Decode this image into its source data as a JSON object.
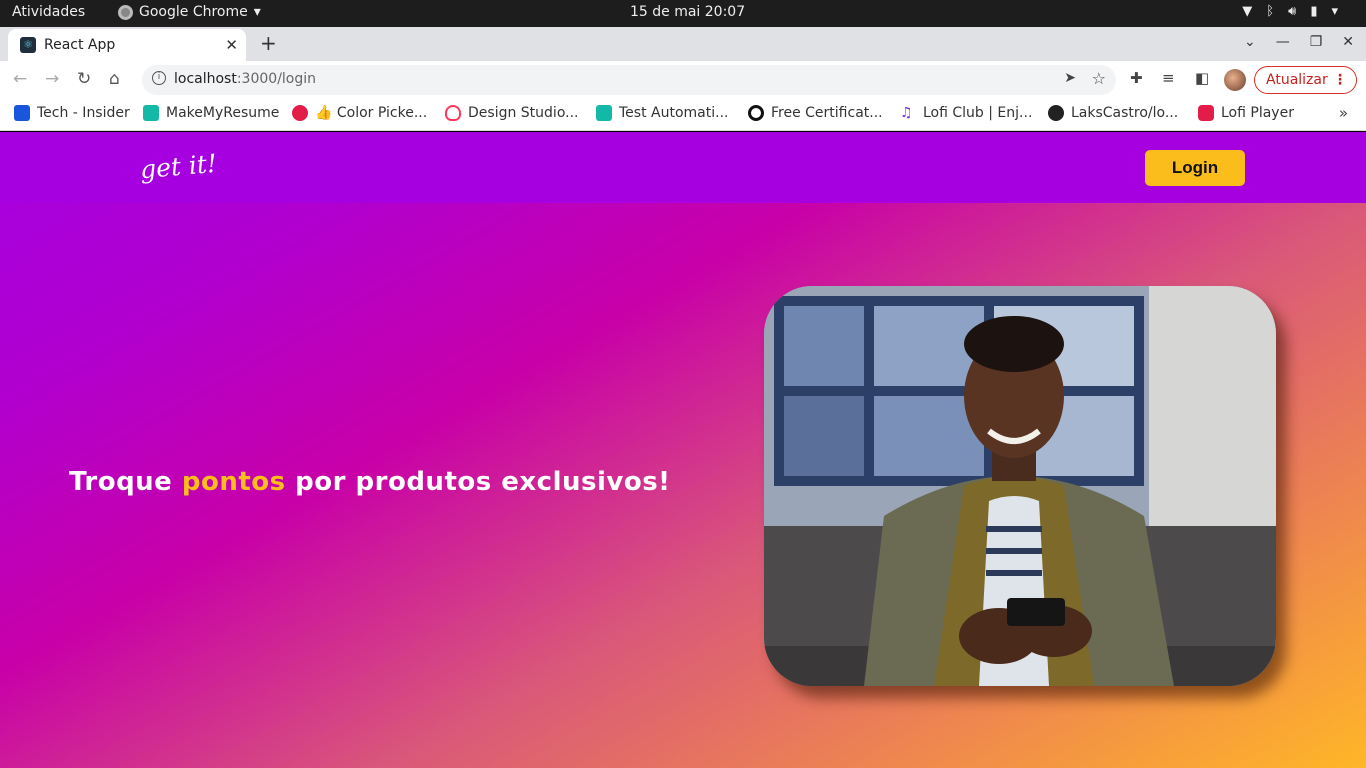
{
  "system": {
    "activities": "Atividades",
    "app_name": "Google Chrome",
    "clock": "15 de mai  20:07"
  },
  "browser": {
    "tab_title": "React App",
    "url_host": "localhost",
    "url_path": ":3000/login",
    "update_label": "Atualizar"
  },
  "bookmarks": [
    {
      "label": "Tech - Insider",
      "color": "#1a56db"
    },
    {
      "label": "MakeMyResume",
      "color": "#14b8a6"
    },
    {
      "label": "👍 Color Picke...",
      "color": "#e11d48"
    },
    {
      "label": "Design Studio...",
      "color": "#ff385c"
    },
    {
      "label": "Test Automati...",
      "color": "#14b8a6"
    },
    {
      "label": "Free Certificat...",
      "color": "#111111"
    },
    {
      "label": "Lofi Club | Enj...",
      "color": "#7c3aed"
    },
    {
      "label": "LaksCastro/lo...",
      "color": "#222222"
    },
    {
      "label": "Lofi Player",
      "color": "#e11d48"
    }
  ],
  "site": {
    "logo": "get it!",
    "login_label": "Login",
    "hero_before": "Troque ",
    "hero_accent": "pontos",
    "hero_after": " por produtos exclusivos!",
    "colors": {
      "navbar": "#a600e0",
      "accent": "#fbbd1c",
      "gradient_start": "#a600e0",
      "gradient_end": "#ffb627"
    }
  }
}
